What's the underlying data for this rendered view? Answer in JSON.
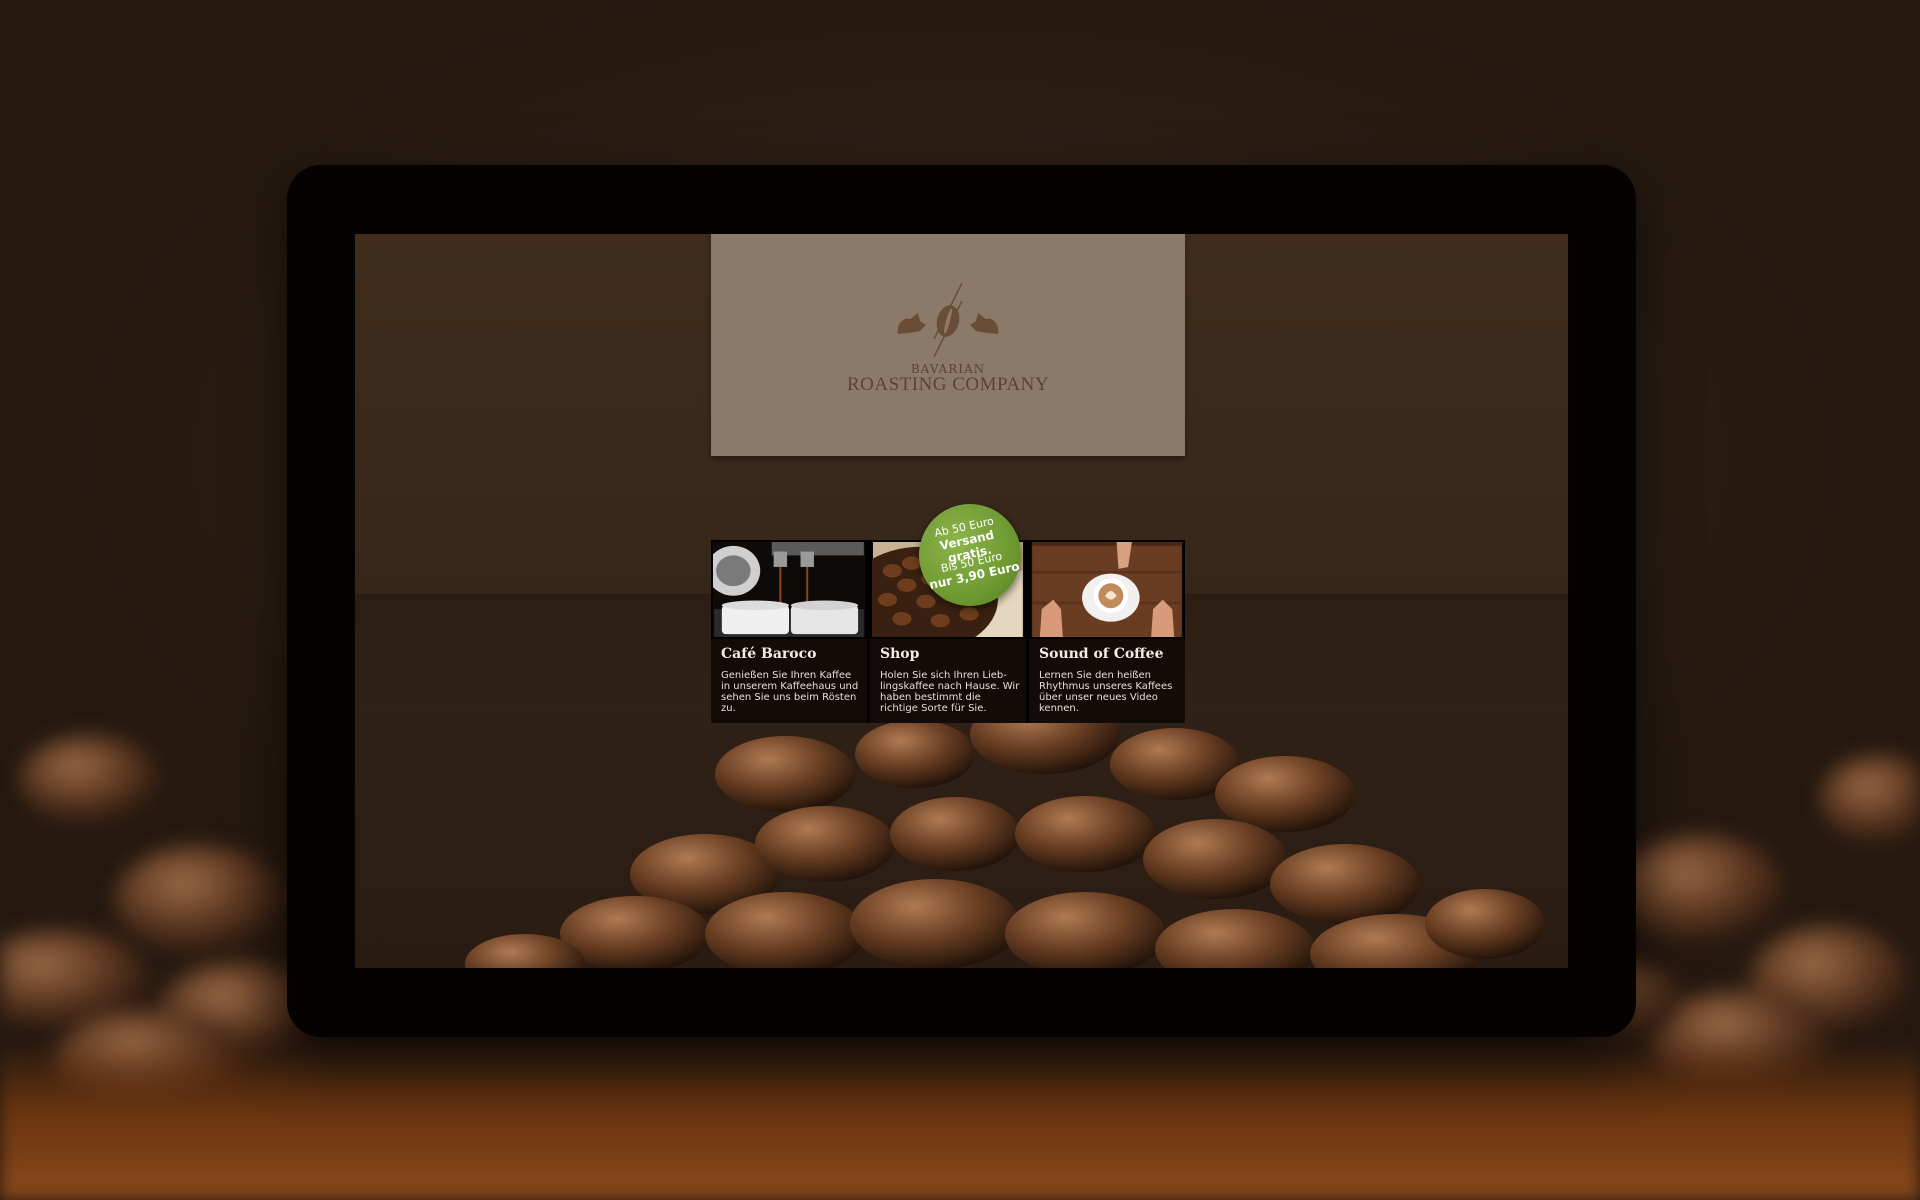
{
  "brand": {
    "small": "BAVARIAN",
    "name": "ROASTING COMPANY"
  },
  "badge": {
    "line1": "Ab 50 Euro",
    "line2": "Versand gratis.",
    "line3": "Bis 50 Euro",
    "line4": "nur 3,90 Euro"
  },
  "cards": [
    {
      "title": "Café Baroco",
      "text": "Genießen Sie Ihren Kaffee in unserem Kaffeehaus und sehen Sie uns beim Rösten zu."
    },
    {
      "title": "Shop",
      "text": "Holen Sie sich Ihren Lieb­lingskaffee nach Hause. Wir haben bestimmt die richtige Sorte für Sie."
    },
    {
      "title": "Sound of Coffee",
      "text": "Lernen Sie den heißen Rhythmus unseres Kaffees über unser neues Video kennen."
    }
  ],
  "colors": {
    "logo_panel": "#8b7a6a",
    "badge_green": "#6f9a32",
    "card_bg": "#120b07"
  }
}
